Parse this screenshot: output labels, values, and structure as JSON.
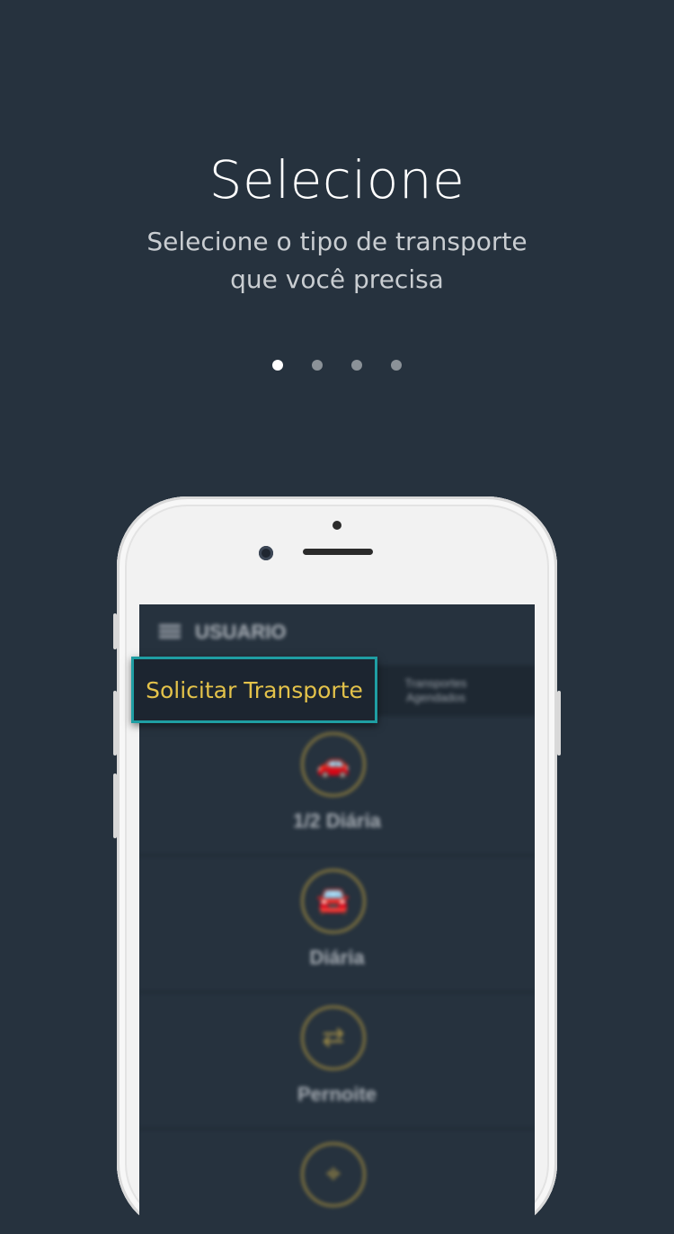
{
  "header": {
    "title": "Selecione",
    "subtitle_line1": "Selecione o tipo de transporte",
    "subtitle_line2": "que você precisa"
  },
  "pagination": {
    "total": 4,
    "current": 1
  },
  "phone_screen": {
    "app_title": "USUARIO",
    "tabs": {
      "left": "Solicitar Transporte",
      "right": "Transportes Agendados"
    },
    "options": [
      {
        "label": "1/2 Diária",
        "icon": "car-crash-icon"
      },
      {
        "label": "Diária",
        "icon": "car-icon"
      },
      {
        "label": "Pernoite",
        "icon": "swap-icon"
      },
      {
        "label": "",
        "icon": "location-pin-icon"
      }
    ]
  },
  "colors": {
    "background": "#26323e",
    "accent_gold": "#e3c24a",
    "highlight_border": "#1f9ea3"
  }
}
